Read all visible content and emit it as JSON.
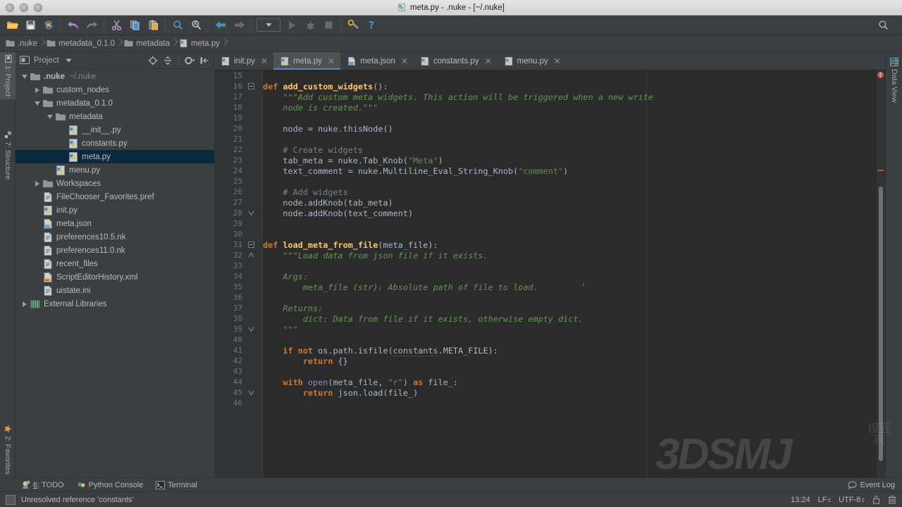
{
  "window": {
    "title": "meta.py - .nuke - [~/.nuke]",
    "title_icon": "python-file-icon"
  },
  "toolbar": {
    "buttons": [
      {
        "name": "open-folder-icon",
        "label": "Open"
      },
      {
        "name": "save-all-icon",
        "label": "Save All"
      },
      {
        "name": "sync-icon",
        "label": "Synchronize"
      },
      {
        "name": "undo-icon",
        "label": "Undo"
      },
      {
        "name": "redo-icon",
        "label": "Redo"
      },
      {
        "name": "cut-icon",
        "label": "Cut"
      },
      {
        "name": "copy-icon",
        "label": "Copy"
      },
      {
        "name": "paste-icon",
        "label": "Paste"
      },
      {
        "name": "find-icon",
        "label": "Find"
      },
      {
        "name": "replace-icon",
        "label": "Replace"
      },
      {
        "name": "back-icon",
        "label": "Back"
      },
      {
        "name": "forward-icon",
        "label": "Forward"
      },
      {
        "name": "run-config-dropdown",
        "label": "Select Run/Debug Configuration"
      },
      {
        "name": "run-icon",
        "label": "Run"
      },
      {
        "name": "debug-icon",
        "label": "Debug"
      },
      {
        "name": "stop-icon",
        "label": "Stop"
      },
      {
        "name": "settings-icon",
        "label": "Settings"
      },
      {
        "name": "help-icon",
        "label": "Help"
      },
      {
        "name": "search-everywhere-icon",
        "label": "Search Everywhere"
      }
    ]
  },
  "breadcrumb": {
    "items": [
      {
        "label": ".nuke",
        "icon": "folder-icon"
      },
      {
        "label": "metadata_0.1.0",
        "icon": "folder-icon"
      },
      {
        "label": "metadata",
        "icon": "folder-icon"
      },
      {
        "label": "meta.py",
        "icon": "python-file-icon"
      }
    ]
  },
  "left_strip": {
    "items": [
      {
        "label": "1: Project",
        "key": "1",
        "rest": ": Project",
        "active": true,
        "icon": "project-icon"
      },
      {
        "label": "7: Structure",
        "key": "7",
        "rest": ": Structure",
        "active": false,
        "icon": "structure-icon"
      },
      {
        "label": "2: Favorites",
        "key": "2",
        "rest": ": Favorites",
        "active": false,
        "icon": "star-icon"
      }
    ]
  },
  "right_strip": {
    "items": [
      {
        "label": "Data View",
        "icon": "data-view-icon"
      }
    ]
  },
  "project_panel": {
    "title": "Project",
    "tools": [
      {
        "name": "locate-target-icon"
      },
      {
        "name": "collapse-all-icon"
      },
      {
        "name": "panel-settings-gear-icon"
      },
      {
        "name": "hide-panel-icon"
      }
    ],
    "tree": [
      {
        "label": ".nuke",
        "path": "~/.nuke",
        "indent": 0,
        "arrow": "down",
        "icon": "folder-icon",
        "bold": true,
        "selected": false
      },
      {
        "label": "custom_nodes",
        "path": "",
        "indent": 1,
        "arrow": "right",
        "icon": "folder-icon",
        "bold": false,
        "selected": false
      },
      {
        "label": "metadata_0.1.0",
        "path": "",
        "indent": 1,
        "arrow": "down",
        "icon": "folder-icon",
        "bold": false,
        "selected": false
      },
      {
        "label": "metadata",
        "path": "",
        "indent": 2,
        "arrow": "down",
        "icon": "folder-icon",
        "bold": false,
        "selected": false
      },
      {
        "label": "__init__.py",
        "path": "",
        "indent": 3,
        "arrow": "none",
        "icon": "python-file-icon",
        "bold": false,
        "selected": false
      },
      {
        "label": "constants.py",
        "path": "",
        "indent": 3,
        "arrow": "none",
        "icon": "python-file-icon",
        "bold": false,
        "selected": false
      },
      {
        "label": "meta.py",
        "path": "",
        "indent": 3,
        "arrow": "none",
        "icon": "python-file-icon",
        "bold": false,
        "selected": true
      },
      {
        "label": "menu.py",
        "path": "",
        "indent": 2,
        "arrow": "none",
        "icon": "python-file-icon",
        "bold": false,
        "selected": false
      },
      {
        "label": "Workspaces",
        "path": "",
        "indent": 1,
        "arrow": "right",
        "icon": "folder-icon",
        "bold": false,
        "selected": false
      },
      {
        "label": "FileChooser_Favorites.pref",
        "path": "",
        "indent": 1,
        "arrow": "none",
        "icon": "text-file-icon",
        "bold": false,
        "selected": false
      },
      {
        "label": "init.py",
        "path": "",
        "indent": 1,
        "arrow": "none",
        "icon": "python-file-icon",
        "bold": false,
        "selected": false
      },
      {
        "label": "meta.json",
        "path": "",
        "indent": 1,
        "arrow": "none",
        "icon": "json-file-icon",
        "bold": false,
        "selected": false
      },
      {
        "label": "preferences10.5.nk",
        "path": "",
        "indent": 1,
        "arrow": "none",
        "icon": "text-file-icon",
        "bold": false,
        "selected": false
      },
      {
        "label": "preferences11.0.nk",
        "path": "",
        "indent": 1,
        "arrow": "none",
        "icon": "text-file-icon",
        "bold": false,
        "selected": false
      },
      {
        "label": "recent_files",
        "path": "",
        "indent": 1,
        "arrow": "none",
        "icon": "text-file-icon",
        "bold": false,
        "selected": false
      },
      {
        "label": "ScriptEditorHistory.xml",
        "path": "",
        "indent": 1,
        "arrow": "none",
        "icon": "xml-file-icon",
        "bold": false,
        "selected": false
      },
      {
        "label": "uistate.ini",
        "path": "",
        "indent": 1,
        "arrow": "none",
        "icon": "text-file-icon",
        "bold": false,
        "selected": false
      },
      {
        "label": "External Libraries",
        "path": "",
        "indent": 0,
        "arrow": "right",
        "icon": "library-icon",
        "bold": false,
        "selected": false
      }
    ]
  },
  "editor": {
    "tabs": [
      {
        "label": "init.py",
        "icon": "python-file-icon",
        "active": false
      },
      {
        "label": "meta.py",
        "icon": "python-file-icon",
        "active": true
      },
      {
        "label": "meta.json",
        "icon": "json-file-icon",
        "active": false
      },
      {
        "label": "constants.py",
        "icon": "python-file-icon",
        "active": false
      },
      {
        "label": "menu.py",
        "icon": "python-file-icon",
        "active": false
      }
    ],
    "first_line_number": 15,
    "code_lines": [
      {
        "n": 15,
        "fold": "none",
        "tokens": []
      },
      {
        "n": 16,
        "fold": "open",
        "tokens": [
          {
            "t": "def ",
            "c": "kw"
          },
          {
            "t": "add_custom_widgets",
            "c": "fn"
          },
          {
            "t": "():",
            "c": "id"
          }
        ]
      },
      {
        "n": 17,
        "fold": "none",
        "tokens": [
          {
            "t": "    \"\"\"Add custom meta widgets. This action will be triggered when a new write",
            "c": "doc"
          }
        ]
      },
      {
        "n": 18,
        "fold": "none",
        "tokens": [
          {
            "t": "    node is created.\"\"\"",
            "c": "doc"
          }
        ]
      },
      {
        "n": 19,
        "fold": "none",
        "tokens": []
      },
      {
        "n": 20,
        "fold": "none",
        "tokens": [
          {
            "t": "    node = nuke.thisNode()",
            "c": "id"
          }
        ]
      },
      {
        "n": 21,
        "fold": "none",
        "tokens": []
      },
      {
        "n": 22,
        "fold": "none",
        "tokens": [
          {
            "t": "    # Create widgets",
            "c": "cmt"
          }
        ]
      },
      {
        "n": 23,
        "fold": "none",
        "tokens": [
          {
            "t": "    tab_meta = nuke.Tab_Knob(",
            "c": "id"
          },
          {
            "t": "\"Meta\"",
            "c": "str"
          },
          {
            "t": ")",
            "c": "id"
          }
        ]
      },
      {
        "n": 24,
        "fold": "none",
        "tokens": [
          {
            "t": "    text_comment = nuke.Multiline_Eval_String_Knob(",
            "c": "id"
          },
          {
            "t": "\"comment\"",
            "c": "str"
          },
          {
            "t": ")",
            "c": "id"
          }
        ]
      },
      {
        "n": 25,
        "fold": "none",
        "tokens": []
      },
      {
        "n": 26,
        "fold": "none",
        "tokens": [
          {
            "t": "    # Add widgets",
            "c": "cmt"
          }
        ]
      },
      {
        "n": 27,
        "fold": "none",
        "tokens": [
          {
            "t": "    node.addKnob(tab_meta)",
            "c": "id"
          }
        ]
      },
      {
        "n": 28,
        "fold": "end",
        "tokens": [
          {
            "t": "    node.addKnob(text_comment)",
            "c": "id"
          }
        ]
      },
      {
        "n": 29,
        "fold": "none",
        "tokens": []
      },
      {
        "n": 30,
        "fold": "none",
        "tokens": []
      },
      {
        "n": 31,
        "fold": "open",
        "tokens": [
          {
            "t": "def ",
            "c": "kw"
          },
          {
            "t": "load_meta_from_file",
            "c": "fn"
          },
          {
            "t": "(meta_file):",
            "c": "id"
          }
        ]
      },
      {
        "n": 32,
        "fold": "open2",
        "tokens": [
          {
            "t": "    \"\"\"Load data from json file if it exists.",
            "c": "doc"
          }
        ]
      },
      {
        "n": 33,
        "fold": "none",
        "tokens": []
      },
      {
        "n": 34,
        "fold": "none",
        "tokens": [
          {
            "t": "    Args:",
            "c": "doc"
          }
        ]
      },
      {
        "n": 35,
        "fold": "none",
        "tokens": [
          {
            "t": "        meta_file (str): Absolute path of file to load.",
            "c": "doc"
          }
        ]
      },
      {
        "n": 36,
        "fold": "none",
        "tokens": []
      },
      {
        "n": 37,
        "fold": "none",
        "tokens": [
          {
            "t": "    Returns:",
            "c": "doc"
          }
        ]
      },
      {
        "n": 38,
        "fold": "none",
        "tokens": [
          {
            "t": "        dict: Data from file if it exists, otherwise empty dict.",
            "c": "doc"
          }
        ]
      },
      {
        "n": 39,
        "fold": "end",
        "tokens": [
          {
            "t": "    \"\"\"",
            "c": "doc"
          }
        ]
      },
      {
        "n": 40,
        "fold": "none",
        "tokens": []
      },
      {
        "n": 41,
        "fold": "none",
        "tokens": [
          {
            "t": "    if ",
            "c": "kw"
          },
          {
            "t": "not ",
            "c": "kw"
          },
          {
            "t": "os.path.isfile(",
            "c": "id"
          },
          {
            "t": "constants",
            "c": "err"
          },
          {
            "t": ".META_FILE):",
            "c": "id"
          }
        ]
      },
      {
        "n": 42,
        "fold": "none",
        "tokens": [
          {
            "t": "        ",
            "c": "id"
          },
          {
            "t": "return ",
            "c": "kw"
          },
          {
            "t": "{}",
            "c": "id"
          }
        ]
      },
      {
        "n": 43,
        "fold": "none",
        "tokens": []
      },
      {
        "n": 44,
        "fold": "none",
        "tokens": [
          {
            "t": "    with ",
            "c": "kw"
          },
          {
            "t": "open",
            "c": "bi"
          },
          {
            "t": "(meta_file, ",
            "c": "id"
          },
          {
            "t": "\"r\"",
            "c": "str"
          },
          {
            "t": ") ",
            "c": "id"
          },
          {
            "t": "as ",
            "c": "kw"
          },
          {
            "t": "file_:",
            "c": "id"
          }
        ]
      },
      {
        "n": 45,
        "fold": "end",
        "tokens": [
          {
            "t": "        ",
            "c": "id"
          },
          {
            "t": "return ",
            "c": "kw"
          },
          {
            "t": "json.load(file_)",
            "c": "id"
          }
        ]
      },
      {
        "n": 46,
        "fold": "none",
        "tokens": []
      }
    ],
    "error_marker_line": 24
  },
  "bottom_bar": {
    "items": [
      {
        "label": "6: TODO",
        "key": "6",
        "rest": ": TODO",
        "icon": "todo-icon"
      },
      {
        "label": "Python Console",
        "key": "",
        "rest": "Python Console",
        "icon": "python-console-icon"
      },
      {
        "label": "Terminal",
        "key": "",
        "rest": "Terminal",
        "icon": "terminal-icon"
      }
    ],
    "event_log": "Event Log"
  },
  "status_bar": {
    "message": "Unresolved reference 'constants'",
    "time": "13:24",
    "line_separator": "LF",
    "encoding": "UTF-8",
    "lock_icon": "lock-icon",
    "trash_icon": "trash-icon"
  },
  "watermark": {
    "text": "3DSMJ",
    "cn_text": "模匠网"
  },
  "colors": {
    "accent": "#4a88c7",
    "selection": "#0d293e",
    "editor_bg": "#2b2b2b",
    "chrome_bg": "#3c3f41",
    "error": "#cc4b43",
    "keyword": "#cc7832",
    "string": "#6a8759",
    "docstring": "#629755",
    "function": "#ffc66d"
  }
}
